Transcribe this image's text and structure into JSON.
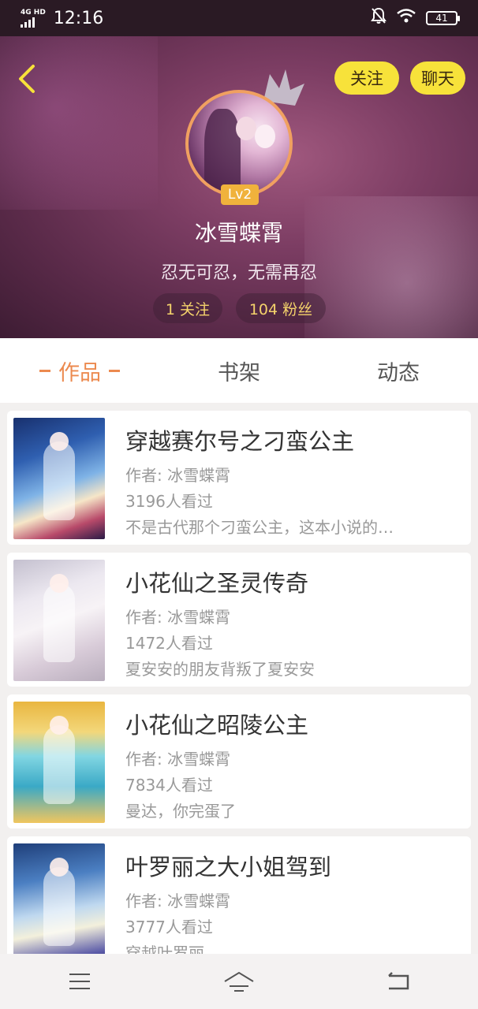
{
  "status_bar": {
    "network": "4G HD",
    "time": "12:16",
    "battery": "41"
  },
  "header": {
    "follow_button": "关注",
    "chat_button": "聊天",
    "level": "Lv2",
    "username": "冰雪蝶霄",
    "bio": "忍无可忍，无需再忍",
    "following": "1 关注",
    "fans": "104 粉丝"
  },
  "tabs": [
    {
      "label": "作品",
      "active": true
    },
    {
      "label": "书架",
      "active": false
    },
    {
      "label": "动态",
      "active": false
    }
  ],
  "works": [
    {
      "title": "穿越赛尔号之刁蛮公主",
      "author": "作者: 冰雪蝶霄",
      "views": "3196人看过",
      "desc": "不是古代那个刁蛮公主，这本小说的…"
    },
    {
      "title": "小花仙之圣灵传奇",
      "author": "作者: 冰雪蝶霄",
      "views": "1472人看过",
      "desc": "夏安安的朋友背叛了夏安安"
    },
    {
      "title": "小花仙之昭陵公主",
      "author": "作者: 冰雪蝶霄",
      "views": "7834人看过",
      "desc": "曼达，你完蛋了"
    },
    {
      "title": "叶罗丽之大小姐驾到",
      "author": "作者: 冰雪蝶霄",
      "views": "3777人看过",
      "desc": "穿越叶罗丽"
    }
  ],
  "colors": {
    "accent": "#ec8a4f",
    "button_yellow": "#f7e23a",
    "level_badge": "#f0b23c"
  },
  "icons": {
    "back": "chevron-left-icon",
    "menu": "menu-icon",
    "home": "home-icon",
    "back_nav": "return-icon"
  }
}
